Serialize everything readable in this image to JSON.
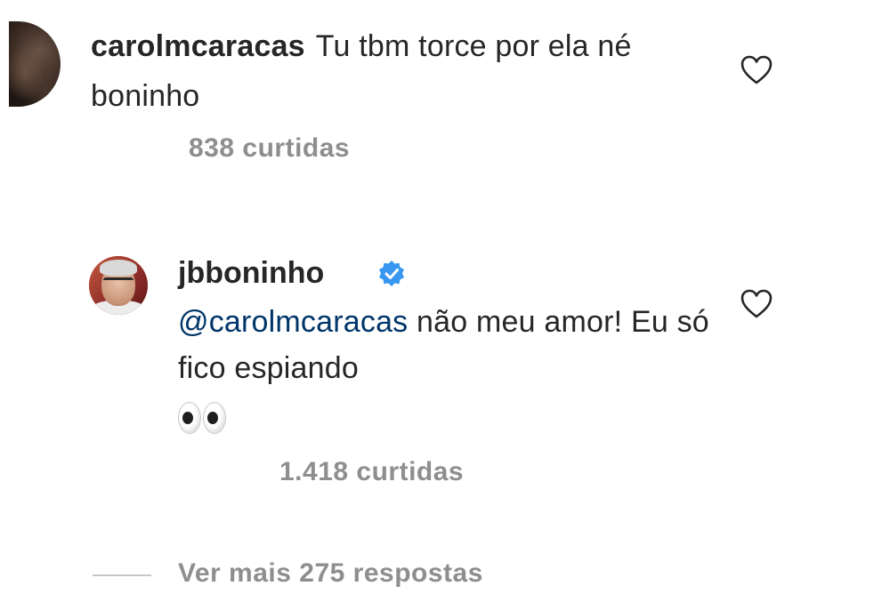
{
  "comments": [
    {
      "username": "carolmcaracas",
      "text": "Tu tbm torce por ela né boninho",
      "likes": "838 curtidas",
      "avatar_icon": "user-avatar-icon",
      "like_icon": "heart-outline-icon"
    },
    {
      "username": "jbboninho",
      "verified": true,
      "verified_icon": "verified-badge-icon",
      "mention": "@carolmcaracas",
      "text": "não meu amor! Eu só fico espiando",
      "emoji": "👀",
      "likes": "1.418 curtidas",
      "avatar_icon": "user-avatar-icon",
      "like_icon": "heart-outline-icon"
    }
  ],
  "view_more": {
    "label": "Ver mais 275 respostas"
  },
  "colors": {
    "text": "#262626",
    "secondary": "#8e8e8e",
    "mention": "#003569",
    "verified": "#3897f0"
  }
}
